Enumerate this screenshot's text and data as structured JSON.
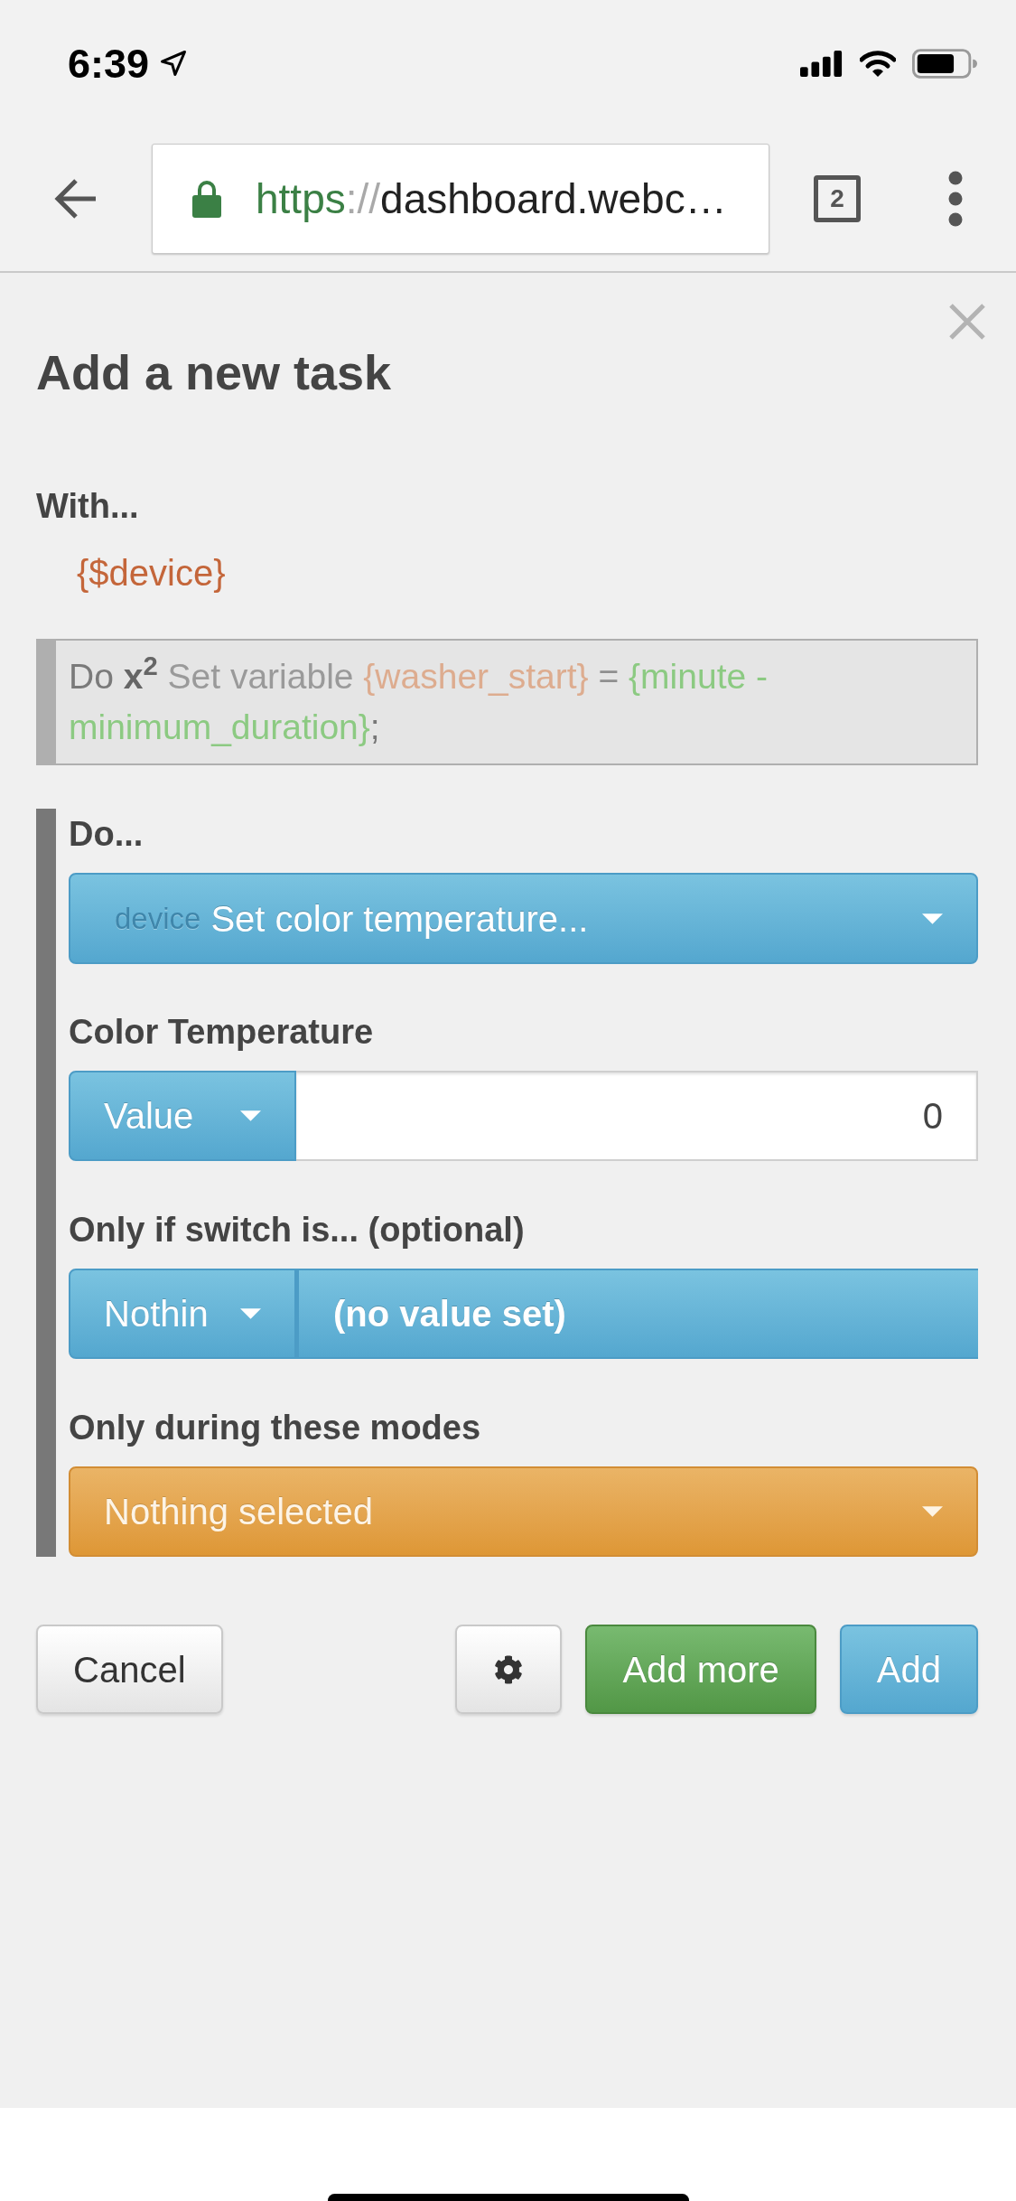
{
  "status_bar": {
    "time": "6:39"
  },
  "browser": {
    "url": {
      "scheme": "https",
      "separator": "://",
      "host": "dashboard.webc…"
    },
    "tab_count": "2"
  },
  "dialog": {
    "title": "Add a new task",
    "with": {
      "label": "With...",
      "device": "{$device}"
    },
    "previous_step": {
      "segments": [
        {
          "kind": "keyword",
          "text": "Do "
        },
        {
          "kind": "bold",
          "text": "x$^{2}$ "
        },
        {
          "kind": "text",
          "text": "Set variable "
        },
        {
          "kind": "variable",
          "text": "{washer_start}"
        },
        {
          "kind": "operator",
          "text": " = "
        },
        {
          "kind": "expression",
          "text": "{minute - minimum_duration}"
        },
        {
          "kind": "punctuation",
          "text": ";"
        }
      ]
    },
    "step": {
      "label": "Do...",
      "action": {
        "tag": "device",
        "value": "Set color temperature..."
      },
      "fields": [
        {
          "kind": "number",
          "label": "Color Temperature",
          "mode": "Value",
          "value": "0"
        },
        {
          "kind": "switch",
          "label": "Only if switch is... (optional)",
          "mode": "Nothin",
          "value": "(no value set)"
        },
        {
          "kind": "modes",
          "label": "Only during these modes",
          "value": "Nothing selected"
        }
      ]
    },
    "buttons": [
      {
        "kind": "default",
        "label": "Cancel"
      },
      {
        "kind": "settings"
      },
      {
        "kind": "success",
        "label": "Add more"
      },
      {
        "kind": "primary",
        "label": "Add"
      }
    ]
  }
}
